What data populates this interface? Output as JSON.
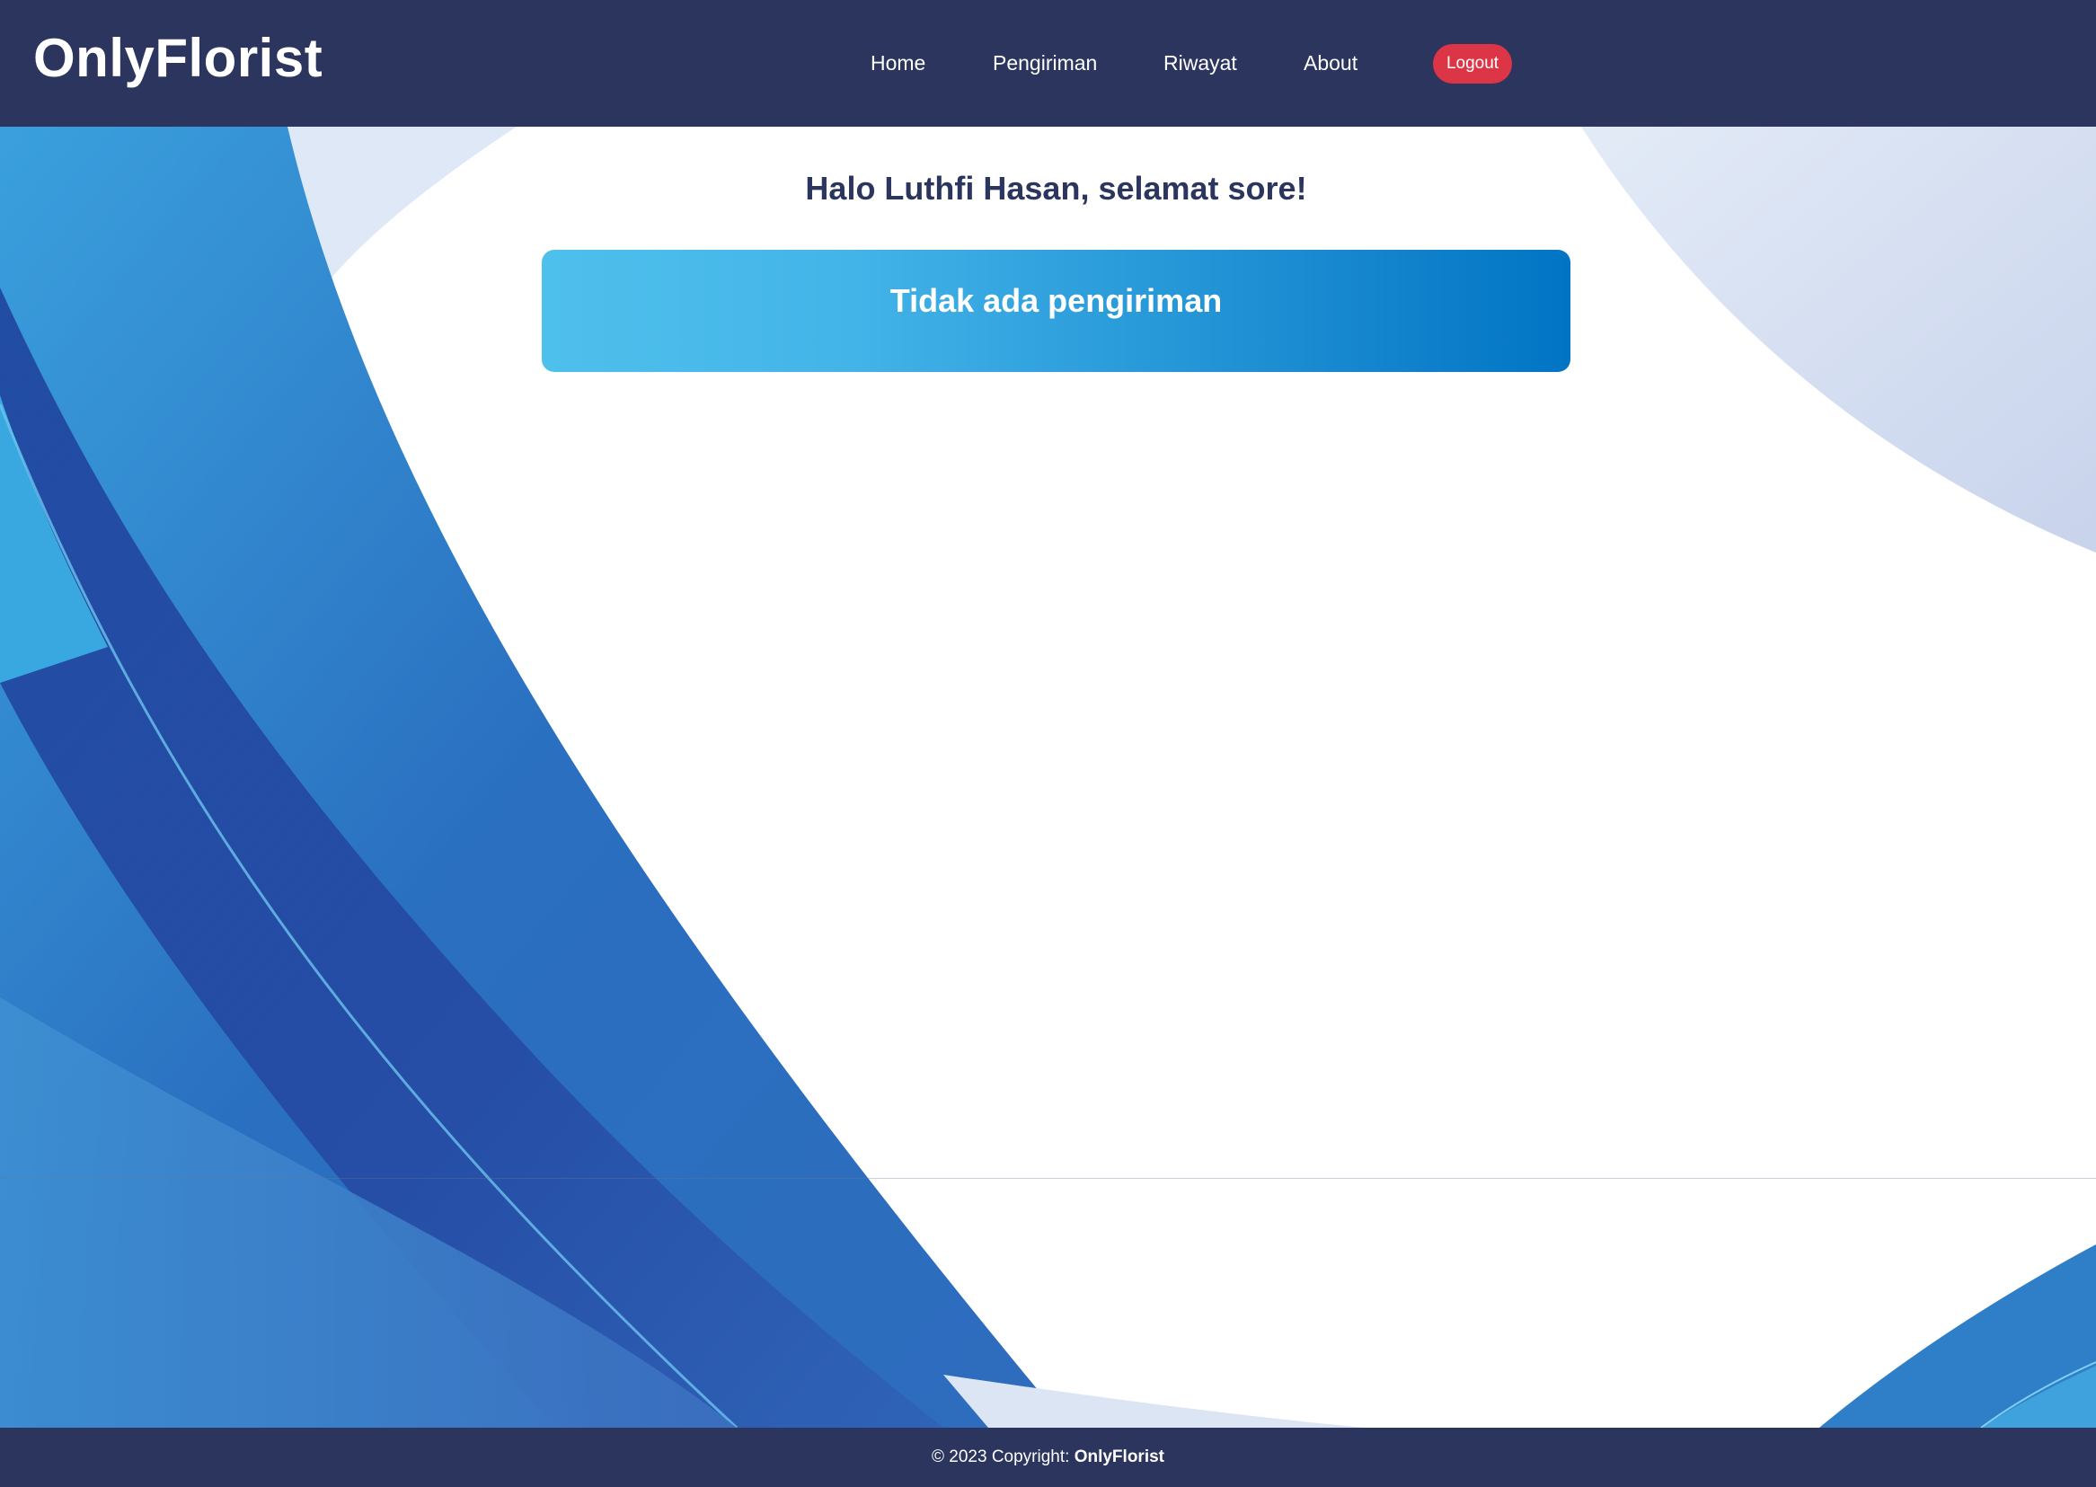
{
  "header": {
    "brand": "OnlyFlorist",
    "nav": {
      "home": "Home",
      "pengiriman": "Pengiriman",
      "riwayat": "Riwayat",
      "about": "About"
    },
    "logout": "Logout"
  },
  "main": {
    "greeting": "Halo Luthfi Hasan, selamat sore!",
    "empty_message": "Tidak ada pengiriman"
  },
  "footer": {
    "copyright": "© 2023 Copyright: ",
    "brand": "OnlyFlorist"
  },
  "colors": {
    "navbar": "#2b355e",
    "logout": "#dc3545",
    "card_start": "#4fc0ec",
    "card_end": "#0174c4",
    "greeting_text": "#2b355e"
  }
}
